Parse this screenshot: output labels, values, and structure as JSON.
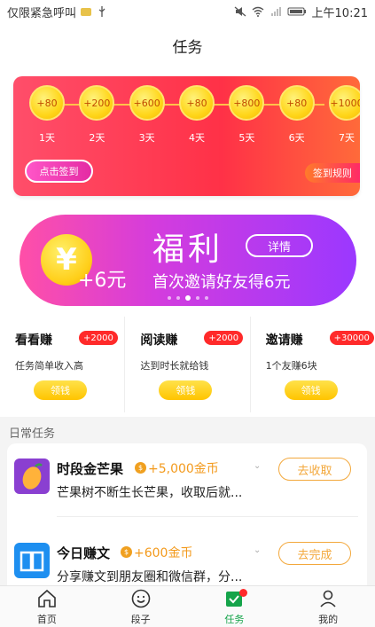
{
  "statusbar": {
    "left_text": "仅限紧急呼叫",
    "time": "上午10:21"
  },
  "header": {
    "title": "任务"
  },
  "signin": {
    "days": [
      {
        "reward": "+80",
        "label": "1天"
      },
      {
        "reward": "+200",
        "label": "2天"
      },
      {
        "reward": "+600",
        "label": "3天"
      },
      {
        "reward": "+80",
        "label": "4天"
      },
      {
        "reward": "+800",
        "label": "5天"
      },
      {
        "reward": "+80",
        "label": "6天"
      },
      {
        "reward": "+1000",
        "label": "7天"
      }
    ],
    "button": "点击签到",
    "rules": "签到规则"
  },
  "banner": {
    "coin_symbol": "¥",
    "amount": "+6元",
    "title": "福利",
    "detail": "详情",
    "subtitle": "首次邀请好友得6元",
    "slides": 5,
    "active_slide": 3
  },
  "tasks": [
    {
      "title": "看看赚",
      "badge": "+2000",
      "desc": "任务简单收入高",
      "button": "领钱"
    },
    {
      "title": "阅读赚",
      "badge": "+2000",
      "desc": "达到时长就给钱",
      "button": "领钱"
    },
    {
      "title": "邀请赚",
      "badge": "+30000",
      "desc": "1个友赚6块",
      "button": "领钱"
    }
  ],
  "daily": {
    "header": "日常任务",
    "items": [
      {
        "title": "时段金芒果",
        "reward": "+5,000金币",
        "desc": "芒果树不断生长芒果，收取后就...",
        "button": "去收取",
        "icon": "mango-icon"
      },
      {
        "title": "今日赚文",
        "reward": "+600金币",
        "desc": "分享赚文到朋友圈和微信群，分...",
        "button": "去完成",
        "icon": "book-icon"
      }
    ]
  },
  "nav": [
    {
      "label": "首页",
      "icon": "home-icon"
    },
    {
      "label": "段子",
      "icon": "smiley-icon"
    },
    {
      "label": "任务",
      "icon": "task-icon"
    },
    {
      "label": "我的",
      "icon": "profile-icon"
    }
  ],
  "colors": {
    "accent_green": "#15a44a",
    "red": "#ff2a2a",
    "gold": "#f3a83c"
  }
}
